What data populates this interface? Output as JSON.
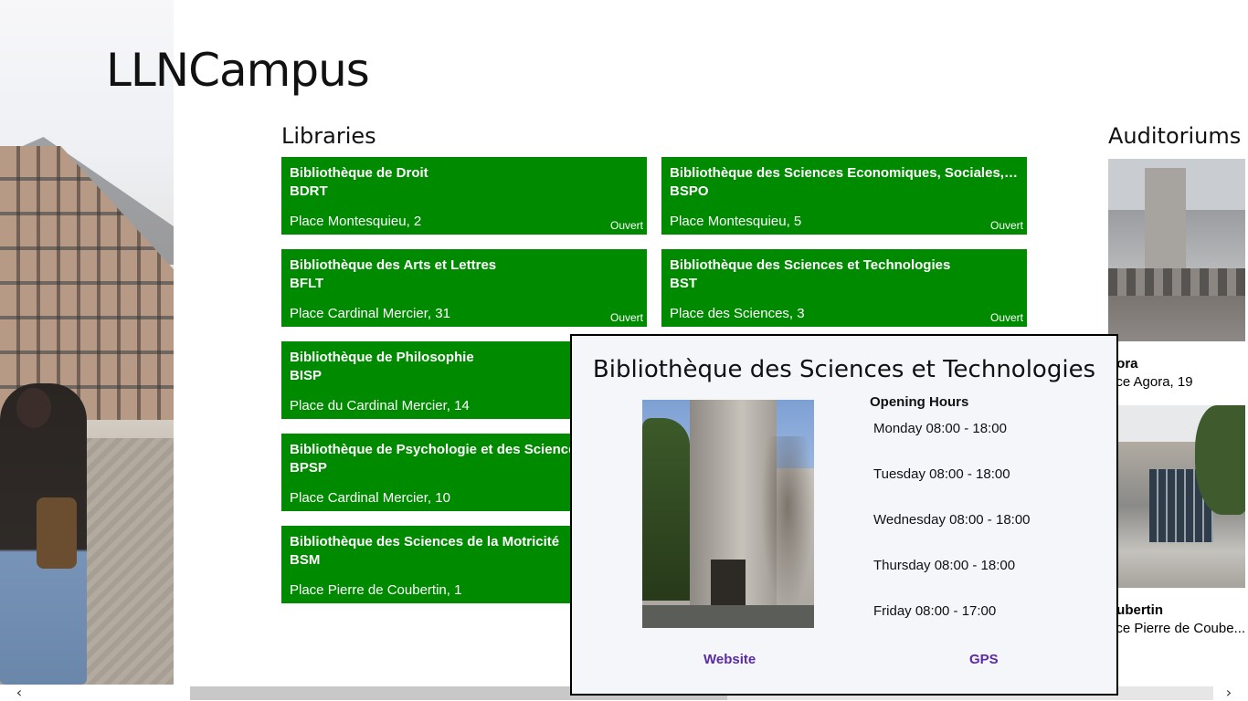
{
  "app": {
    "title": "LLNCampus"
  },
  "sections": {
    "libraries_title": "Libraries",
    "auditoriums_title": "Auditoriums ›"
  },
  "libraries": [
    {
      "name": "Bibliothèque de Droit",
      "code": "BDRT",
      "address": "Place Montesquieu, 2",
      "status": "Ouvert"
    },
    {
      "name": "Bibliothèque des Sciences Economiques, Sociales, Politiq...",
      "code": "BSPO",
      "address": "Place Montesquieu, 5",
      "status": "Ouvert"
    },
    {
      "name": "Bibliothèque des Arts et Lettres",
      "code": "BFLT",
      "address": "Place Cardinal Mercier, 31",
      "status": "Ouvert"
    },
    {
      "name": "Bibliothèque des Sciences et Technologies",
      "code": "BST",
      "address": "Place des Sciences, 3",
      "status": "Ouvert"
    },
    {
      "name": "Bibliothèque de Philosophie",
      "code": "BISP",
      "address": "Place du Cardinal Mercier, 14",
      "status": ""
    },
    {
      "name": "Bibliothèque de Psychologie et des Sciences de",
      "code": "BPSP",
      "address": "Place Cardinal Mercier, 10",
      "status": ""
    },
    {
      "name": "Bibliothèque des Sciences de la Motricité",
      "code": "BSM",
      "address": "Place Pierre de Coubertin, 1",
      "status": ""
    }
  ],
  "auditoriums": [
    {
      "name": "gora",
      "address": "ace Agora, 19"
    },
    {
      "name": "oubertin",
      "address": "ace Pierre de Coube..."
    }
  ],
  "popup": {
    "title": "Bibliothèque des Sciences et Technologies",
    "hours_heading": "Opening Hours",
    "hours": [
      "Monday 08:00 - 18:00",
      "Tuesday 08:00 - 18:00",
      "Wednesday 08:00 - 18:00",
      "Thursday 08:00 - 18:00",
      "Friday 08:00 - 17:00"
    ],
    "website_label": "Website",
    "gps_label": "GPS"
  },
  "scrollbar": {
    "left_arrow": "‹",
    "right_arrow": "›",
    "position_fraction": 0.0
  },
  "colors": {
    "tile_green": "#008a00",
    "link_purple": "#5a2aa8"
  }
}
